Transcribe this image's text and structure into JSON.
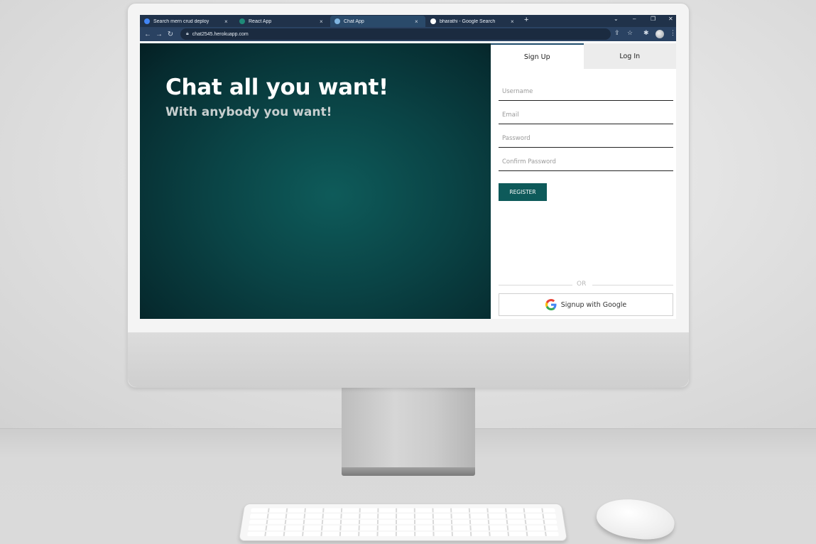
{
  "browser": {
    "tabs": [
      {
        "title": "Search mern crud deploy",
        "close": "×",
        "color": "#4285f4"
      },
      {
        "title": "React App",
        "close": "×",
        "color": "#61dafb"
      },
      {
        "title": "Chat App",
        "close": "×",
        "color": "#7fb5e0"
      },
      {
        "title": "bharathi - Google Search",
        "close": "×",
        "color": "#ffffff"
      }
    ],
    "new_tab": "+",
    "url": "chat2545.herokuapp.com"
  },
  "hero": {
    "title": "Chat all you want!",
    "subtitle": "With anybody you want!"
  },
  "auth": {
    "tab_signup": "Sign Up",
    "tab_login": "Log In",
    "username_placeholder": "Username",
    "email_placeholder": "Email",
    "password_placeholder": "Password",
    "confirm_placeholder": "Confirm Password",
    "register_label": "REGISTER",
    "or_label": "OR",
    "google_label": "Signup with Google"
  },
  "colors": {
    "accent": "#0e5a5a",
    "tabbar": "#20324a"
  }
}
